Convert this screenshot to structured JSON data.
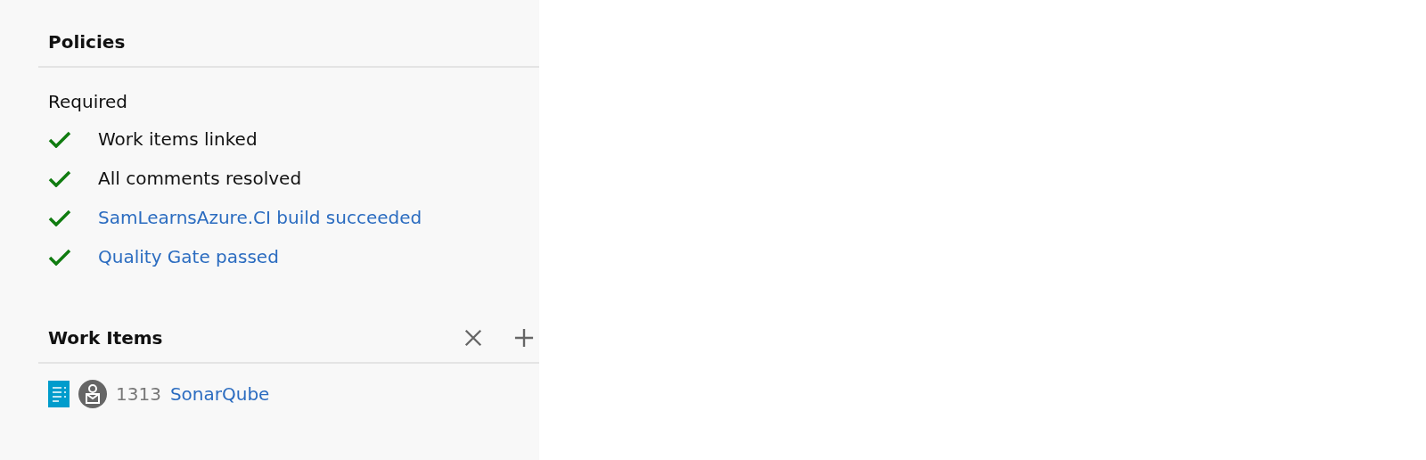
{
  "policies": {
    "title": "Policies",
    "group": "Required",
    "items": [
      {
        "label": "Work items linked",
        "passed": true,
        "kind": "text"
      },
      {
        "label": "All comments resolved",
        "passed": true,
        "kind": "text"
      },
      {
        "label": "SamLearnsAzure.CI build succeeded",
        "passed": true,
        "kind": "link"
      },
      {
        "label": "Quality Gate passed",
        "passed": true,
        "kind": "link"
      }
    ]
  },
  "work_items": {
    "title": "Work Items",
    "items": [
      {
        "id": "1313",
        "title": "SonarQube"
      }
    ]
  }
}
